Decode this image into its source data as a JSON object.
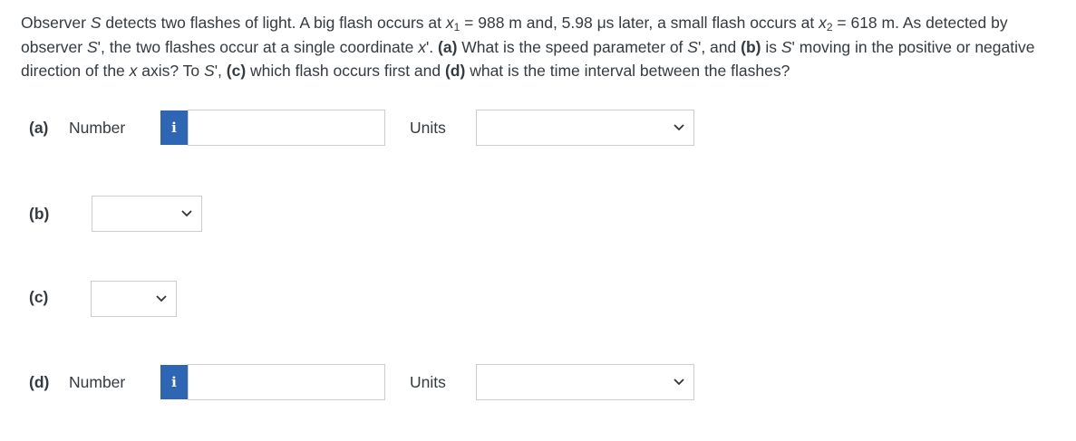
{
  "question": {
    "s1": "Observer ",
    "s2": "S",
    "s3": " detects two flashes of light. A big flash occurs at ",
    "s4": "x",
    "s5": "1",
    "s6": " = 988 m and, 5.98 μs later, a small flash occurs at ",
    "s7": "x",
    "s8": "2",
    "s9": " = 618 m. As detected by observer ",
    "s10": "S",
    "s11": "', the two flashes occur at a single coordinate ",
    "s12": "x",
    "s13": "'. ",
    "s14": "(a)",
    "s15": " What is the speed parameter of ",
    "s16": "S",
    "s17": "', and ",
    "s18": "(b)",
    "s19": " is ",
    "s20": "S",
    "s21": "' moving in the positive or negative direction of the ",
    "s22": "x",
    "s23": " axis? To ",
    "s24": "S",
    "s25": "', ",
    "s26": "(c)",
    "s27": " which flash occurs first and ",
    "s28": "(d)",
    "s29": " what is the time interval between the flashes?"
  },
  "parts": {
    "a": {
      "label": "(a)",
      "number_label": "Number",
      "info": "i",
      "value": "",
      "units_label": "Units",
      "units_value": ""
    },
    "b": {
      "label": "(b)",
      "value": ""
    },
    "c": {
      "label": "(c)",
      "value": ""
    },
    "d": {
      "label": "(d)",
      "number_label": "Number",
      "info": "i",
      "value": "",
      "units_label": "Units",
      "units_value": ""
    }
  },
  "icons": {
    "info": "info-icon",
    "chevron": "chevron-down-icon"
  },
  "colors": {
    "info_button": "#2f66b3",
    "text": "#333a40",
    "border": "#cccccc"
  }
}
